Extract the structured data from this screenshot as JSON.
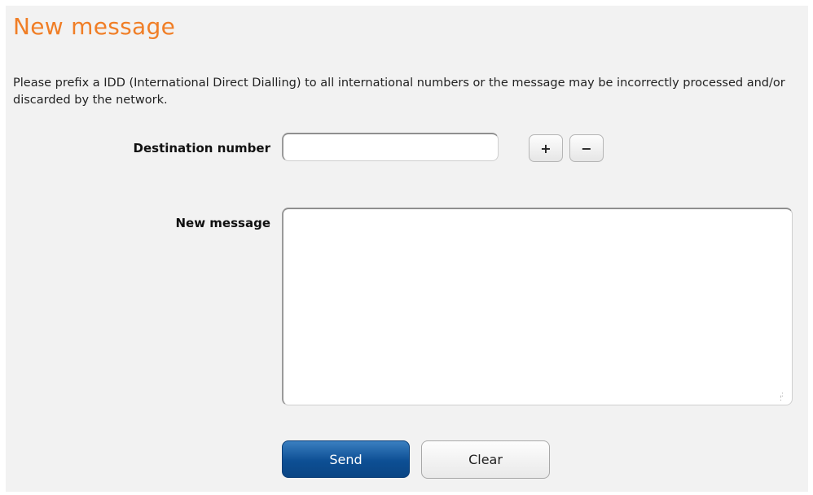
{
  "page": {
    "title": "New message",
    "notice": "Please prefix a IDD (International Direct Dialling) to all international numbers or the message may be incorrectly processed and/or discarded by the network."
  },
  "form": {
    "destination_label": "Destination number",
    "destination_value": "",
    "add_label": "+",
    "remove_label": "−",
    "message_label": "New message",
    "message_value": ""
  },
  "actions": {
    "send_label": "Send",
    "clear_label": "Clear"
  },
  "colors": {
    "title": "#f07e26",
    "send_button": "#0d4f94",
    "panel_background": "#f2f2f2"
  }
}
